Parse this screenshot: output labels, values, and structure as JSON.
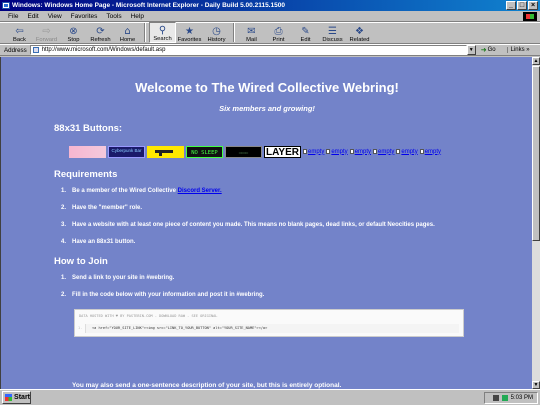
{
  "window": {
    "title": "Windows: Windows Home Page - Microsoft Internet Explorer - Daily Build 5.00.2115.1500",
    "controls": [
      "_",
      "□",
      "×"
    ]
  },
  "menu": [
    "File",
    "Edit",
    "View",
    "Favorites",
    "Tools",
    "Help"
  ],
  "toolbar": [
    {
      "label": "Back",
      "icon": "back-arrow-icon",
      "glyph": "⇦",
      "disabled": false
    },
    {
      "label": "Forward",
      "icon": "forward-arrow-icon",
      "glyph": "⇨",
      "disabled": true
    },
    {
      "label": "Stop",
      "icon": "stop-icon",
      "glyph": "⊗",
      "disabled": false
    },
    {
      "label": "Refresh",
      "icon": "refresh-icon",
      "glyph": "⟳",
      "disabled": false
    },
    {
      "label": "Home",
      "icon": "home-icon",
      "glyph": "⌂",
      "disabled": false
    },
    {
      "label": "Search",
      "icon": "search-icon",
      "glyph": "⚲",
      "disabled": false,
      "active": true
    },
    {
      "label": "Favorites",
      "icon": "favorites-icon",
      "glyph": "★",
      "disabled": false
    },
    {
      "label": "History",
      "icon": "history-icon",
      "glyph": "◷",
      "disabled": false
    },
    {
      "label": "Mail",
      "icon": "mail-icon",
      "glyph": "✉",
      "disabled": false
    },
    {
      "label": "Print",
      "icon": "print-icon",
      "glyph": "⎙",
      "disabled": false
    },
    {
      "label": "Edit",
      "icon": "edit-icon",
      "glyph": "✎",
      "disabled": false
    },
    {
      "label": "Discuss",
      "icon": "discuss-icon",
      "glyph": "☰",
      "disabled": false
    },
    {
      "label": "Related",
      "icon": "related-icon",
      "glyph": "❖",
      "disabled": false
    }
  ],
  "address": {
    "label": "Address",
    "url": "http://www.microsoft.com/Windows/default.asp",
    "go": "Go",
    "links": "Links"
  },
  "page": {
    "title": "Welcome to The Wired Collective Webring!",
    "subtitle": "Six members and growing!",
    "buttons_heading": "88x31 Buttons:",
    "buttons": [
      {
        "name": "button-pink",
        "text": ""
      },
      {
        "name": "button-cyberpunk",
        "text": "Cyberpunk Bar"
      },
      {
        "name": "button-yellow-gun",
        "text": ""
      },
      {
        "name": "button-no-sleep",
        "text": "NO SLEEP"
      },
      {
        "name": "button-dark",
        "text": "::::::::::"
      },
      {
        "name": "button-layer",
        "text": "LAYER"
      }
    ],
    "empty_label": "empty",
    "empty_count": 6,
    "requirements_heading": "Requirements",
    "requirements": [
      {
        "num": "1.",
        "text": "Be a member of the Wired Collective ",
        "link": "Discord Server."
      },
      {
        "num": "2.",
        "text": "Have the \"member\" role."
      },
      {
        "num": "3.",
        "text": "Have a website with at least one piece of content you made. This means no blank pages, dead links, or default Neocities pages."
      },
      {
        "num": "4.",
        "text": "Have an 88x31 button."
      }
    ],
    "join_heading": "How to Join",
    "join_steps": [
      {
        "num": "1.",
        "text": "Send a link to your site in #webring."
      },
      {
        "num": "2.",
        "text": "Fill in the code below with your information and post it in #webring."
      }
    ],
    "code_header": "DATA HOSTED WITH ♥ BY PASTEBIN.COM - DOWNLOAD RAW - SEE ORIGINAL",
    "code_line_num": "1.",
    "code": "<a href=\"YOUR_SITE_LINK\"><img src=\"LINK_TO_YOUR_BUTTON\" alt=\"YOUR_SITE_NAME\"></a>",
    "footer": "You may also send a one-sentence description of your site, but this is entirely optional."
  },
  "taskbar": {
    "start": "Start",
    "clock": "5:03 PM"
  },
  "colors": {
    "page_bg": "#7383c9",
    "link": "#0000ee",
    "title_bar": "#000080"
  }
}
